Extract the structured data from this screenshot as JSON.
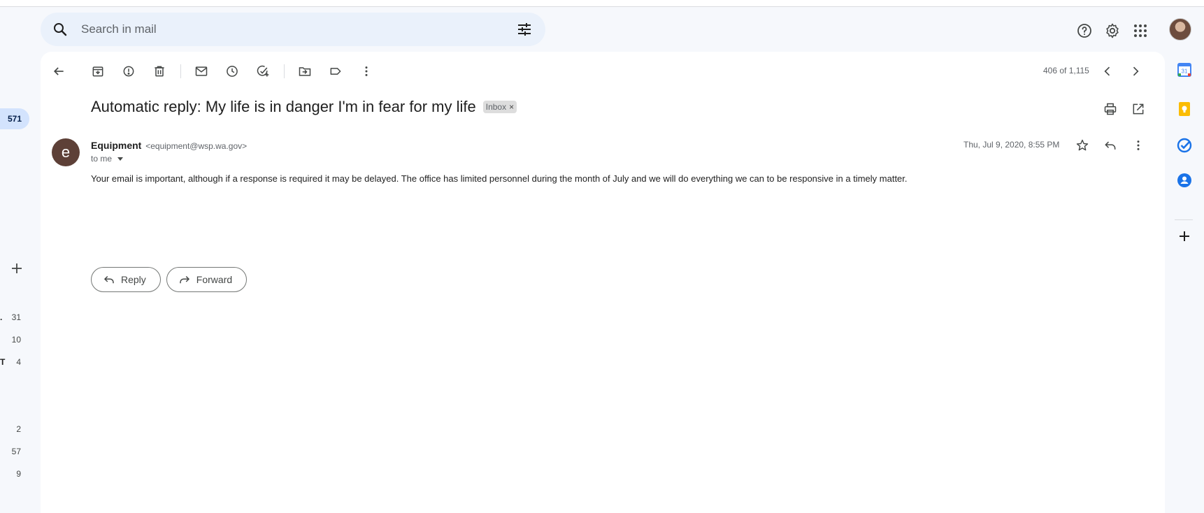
{
  "search": {
    "placeholder": "Search in mail"
  },
  "left_rail": {
    "inbox_count": "571",
    "counts": [
      "31",
      "10",
      "4",
      "2",
      "57",
      "9"
    ],
    "fragments": [
      ".",
      "T"
    ]
  },
  "toolbar": {
    "pager": "406 of 1,115"
  },
  "email": {
    "subject": "Automatic reply: My life is in danger I'm in fear for my life",
    "label": "Inbox",
    "label_remove": "×",
    "sender_initial": "e",
    "sender_name": "Equipment",
    "sender_email": "<equipment@wsp.wa.gov>",
    "to": "to me",
    "date": "Thu, Jul 9, 2020, 8:55 PM",
    "body": "Your email is important, although if a response is required it may be delayed.  The office has limited personnel during the month of July and we will do everything we can to be responsive in a timely matter."
  },
  "actions": {
    "reply": "Reply",
    "forward": "Forward"
  },
  "side_apps": {
    "calendar_day": "31"
  },
  "colors": {
    "background": "#f6f8fc",
    "search_bg": "#eaf1fb",
    "badge_bg": "#d3e3fd",
    "avatar_bg": "#5d4037",
    "keep_yellow": "#fbbc04",
    "tasks_blue": "#1a73e8"
  }
}
